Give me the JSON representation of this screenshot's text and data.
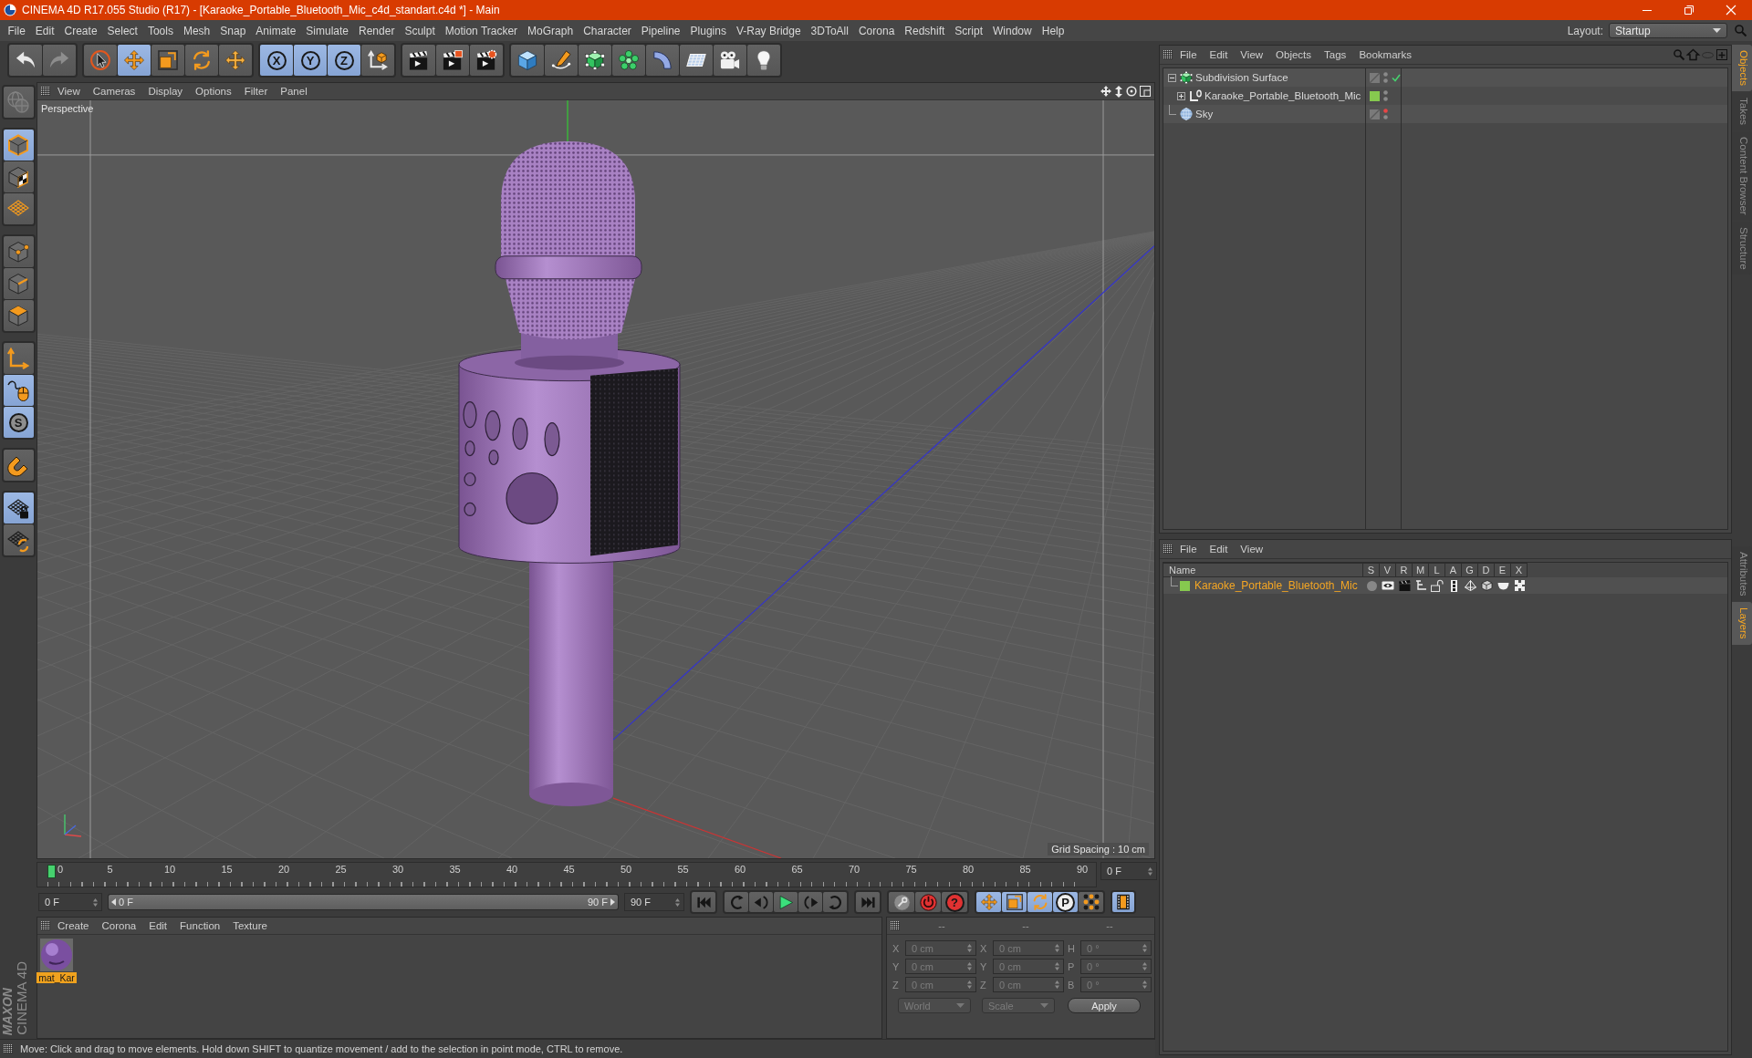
{
  "window": {
    "title": "CINEMA 4D R17.055 Studio (R17) - [Karaoke_Portable_Bluetooth_Mic_c4d_standart.c4d *] - Main"
  },
  "menu_bar": {
    "items": [
      "File",
      "Edit",
      "Create",
      "Select",
      "Tools",
      "Mesh",
      "Snap",
      "Animate",
      "Simulate",
      "Render",
      "Sculpt",
      "Motion Tracker",
      "MoGraph",
      "Character",
      "Pipeline",
      "Plugins",
      "V-Ray Bridge",
      "3DToAll",
      "Corona",
      "Redshift",
      "Script",
      "Window",
      "Help"
    ],
    "layout_label": "Layout:",
    "layout_value": "Startup"
  },
  "toolbar": {
    "groups": [
      [
        {
          "kind": "undo",
          "on": false,
          "disabled": false
        },
        {
          "kind": "redo",
          "on": false,
          "disabled": true
        }
      ],
      [
        {
          "kind": "select",
          "on": false,
          "disabled": false
        },
        {
          "kind": "move",
          "on": true,
          "disabled": false
        },
        {
          "kind": "scale",
          "on": false,
          "disabled": false
        },
        {
          "kind": "rotate",
          "on": false,
          "disabled": false
        },
        {
          "kind": "transform",
          "on": false,
          "disabled": false
        }
      ],
      [
        {
          "kind": "axis",
          "label": "X",
          "on": true,
          "disabled": false
        },
        {
          "kind": "axis",
          "label": "Y",
          "on": true,
          "disabled": false
        },
        {
          "kind": "axis",
          "label": "Z",
          "on": true,
          "disabled": false
        },
        {
          "kind": "coordinates",
          "on": false,
          "disabled": false
        }
      ],
      [
        {
          "kind": "render-view",
          "on": false,
          "disabled": false
        },
        {
          "kind": "render-picture",
          "on": false,
          "disabled": false
        },
        {
          "kind": "render-settings",
          "on": false,
          "disabled": false
        }
      ],
      [
        {
          "kind": "cube",
          "on": false,
          "disabled": false
        },
        {
          "kind": "pen",
          "on": false,
          "disabled": false
        },
        {
          "kind": "subdivision",
          "on": false,
          "disabled": false
        },
        {
          "kind": "cloner",
          "on": false,
          "disabled": false
        },
        {
          "kind": "deformer",
          "on": false,
          "disabled": false
        },
        {
          "kind": "floor",
          "on": false,
          "disabled": false
        },
        {
          "kind": "camera",
          "on": false,
          "disabled": false
        },
        {
          "kind": "light",
          "on": false,
          "disabled": false
        }
      ]
    ]
  },
  "tool_palette": {
    "groups": [
      [
        {
          "kind": "make-editable",
          "on": false,
          "disabled": true
        }
      ],
      [
        {
          "kind": "model",
          "on": true,
          "disabled": false
        },
        {
          "kind": "texture",
          "on": false,
          "disabled": false
        },
        {
          "kind": "workplane",
          "on": false,
          "disabled": false
        }
      ],
      [
        {
          "kind": "points",
          "on": false,
          "disabled": false
        },
        {
          "kind": "edges",
          "on": false,
          "disabled": false
        },
        {
          "kind": "polygons",
          "on": false,
          "disabled": false
        }
      ],
      [
        {
          "kind": "axis-mode",
          "on": false,
          "disabled": false
        },
        {
          "kind": "tweak",
          "on": true,
          "disabled": false
        },
        {
          "kind": "snap",
          "label": "S",
          "on": true,
          "disabled": false
        }
      ],
      [
        {
          "kind": "magnet",
          "on": false,
          "disabled": false
        }
      ],
      [
        {
          "kind": "workplane-lock",
          "on": true,
          "disabled": false
        },
        {
          "kind": "workplane-planar",
          "on": false,
          "disabled": false
        }
      ]
    ]
  },
  "logo": {
    "brand": "MAXON",
    "product": "CINEMA 4D"
  },
  "viewport": {
    "menu": [
      "View",
      "Cameras",
      "Display",
      "Options",
      "Filter",
      "Panel"
    ],
    "camera": "Perspective",
    "grid_spacing": "Grid Spacing : 10 cm"
  },
  "timeline": {
    "frames": [
      "0",
      "5",
      "10",
      "15",
      "20",
      "25",
      "30",
      "35",
      "40",
      "45",
      "50",
      "55",
      "60",
      "65",
      "70",
      "75",
      "80",
      "85",
      "90"
    ],
    "level": 0,
    "current_frame": "0 F"
  },
  "playback": {
    "start": "0 F",
    "range": {
      "start": "0 F",
      "end": "90 F",
      "level": 1
    },
    "end": "90 F",
    "transport": [
      [
        {
          "kind": "go-start"
        }
      ],
      [
        {
          "kind": "prev-key"
        },
        {
          "kind": "prev-frame"
        },
        {
          "kind": "play"
        },
        {
          "kind": "next-frame"
        },
        {
          "kind": "next-key"
        }
      ],
      [
        {
          "kind": "go-end"
        }
      ]
    ],
    "record": [
      {
        "kind": "record-key"
      },
      {
        "kind": "autokey"
      },
      {
        "kind": "key-selection",
        "label": "?"
      }
    ],
    "key_filters": [
      {
        "kind": "position",
        "on": true
      },
      {
        "kind": "scale",
        "on": true
      },
      {
        "kind": "rotation",
        "on": true
      },
      {
        "kind": "parameter",
        "label": "P",
        "on": true
      },
      {
        "kind": "point-level",
        "on": false
      }
    ],
    "timeline_button": {
      "on": true
    }
  },
  "material_manager": {
    "menu": [
      "Create",
      "Corona",
      "Edit",
      "Function",
      "Texture"
    ],
    "materials": [
      {
        "name": "mat_Kar",
        "selected": true
      }
    ]
  },
  "coordinates": {
    "disabled": true,
    "headers": [
      "--",
      "--",
      "--"
    ],
    "rows": [
      [
        {
          "axis": "X",
          "value": "0 cm"
        },
        {
          "axis": "X",
          "value": "0 cm"
        },
        {
          "axis": "H",
          "value": "0 °"
        }
      ],
      [
        {
          "axis": "Y",
          "value": "0 cm"
        },
        {
          "axis": "Y",
          "value": "0 cm"
        },
        {
          "axis": "P",
          "value": "0 °"
        }
      ],
      [
        {
          "axis": "Z",
          "value": "0 cm"
        },
        {
          "axis": "Z",
          "value": "0 cm"
        },
        {
          "axis": "B",
          "value": "0 °"
        }
      ]
    ],
    "dropdowns": [
      "World",
      "Scale"
    ],
    "apply": "Apply"
  },
  "status_bar": {
    "text": "Move: Click and drag to move elements. Hold down SHIFT to quantize movement / add to the selection in point mode, CTRL to remove."
  },
  "object_manager": {
    "menu": [
      "File",
      "Edit",
      "View",
      "Objects",
      "Tags",
      "Bookmarks"
    ],
    "objects": [
      {
        "name": "Subdivision Surface",
        "kind": "subdivision",
        "expandable": true,
        "expanded": true,
        "editor_hidden": false,
        "render_hidden": false,
        "enabled": true,
        "children": [
          {
            "name": "Karaoke_Portable_Bluetooth_Mic",
            "kind": "null",
            "expandable": true,
            "expanded": false,
            "color": "#86c94f",
            "editor_hidden": false,
            "render_hidden": false,
            "enabled": false
          }
        ]
      },
      {
        "name": "Sky",
        "kind": "sky",
        "expandable": false,
        "expanded": false,
        "editor_hidden": true,
        "render_hidden": false,
        "enabled": false
      }
    ]
  },
  "layer_manager": {
    "menu": [
      "File",
      "Edit",
      "View"
    ],
    "columns": [
      "Name",
      "S",
      "V",
      "R",
      "M",
      "L",
      "A",
      "G",
      "D",
      "E",
      "X"
    ],
    "layers": [
      {
        "name": "Karaoke_Portable_Bluetooth_Mic",
        "color": "#86c94f",
        "selected": true,
        "solo": false,
        "locked": false
      }
    ]
  },
  "side_tabs": {
    "upper": [
      {
        "label": "Objects",
        "selected": true
      },
      {
        "label": "Takes",
        "selected": false
      },
      {
        "label": "Content Browser",
        "selected": false
      },
      {
        "label": "Structure",
        "selected": false
      }
    ],
    "lower": [
      {
        "label": "Attributes",
        "selected": false
      },
      {
        "label": "Layers",
        "selected": true
      }
    ]
  }
}
